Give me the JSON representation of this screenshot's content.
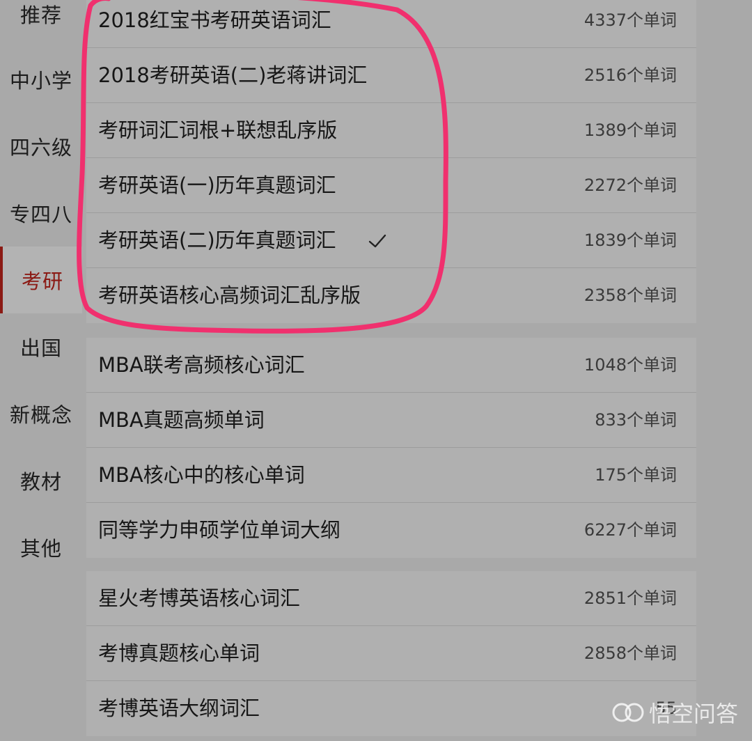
{
  "sidebar": {
    "items": [
      {
        "label": "推荐"
      },
      {
        "label": "中小学"
      },
      {
        "label": "四六级"
      },
      {
        "label": "专四八"
      },
      {
        "label": "考研",
        "active": true
      },
      {
        "label": "出国"
      },
      {
        "label": "新概念"
      },
      {
        "label": "教材"
      },
      {
        "label": "其他"
      }
    ]
  },
  "groups": [
    {
      "rows": [
        {
          "name": "2018红宝书考研英语词汇",
          "count": "4337个单词"
        },
        {
          "name": "2018考研英语(二)老蒋讲词汇",
          "count": "2516个单词"
        },
        {
          "name": "考研词汇词根+联想乱序版",
          "count": "1389个单词"
        },
        {
          "name": "考研英语(一)历年真题词汇",
          "count": "2272个单词"
        },
        {
          "name": "考研英语(二)历年真题词汇",
          "count": "1839个单词",
          "selected": true
        },
        {
          "name": "考研英语核心高频词汇乱序版",
          "count": "2358个单词"
        }
      ]
    },
    {
      "rows": [
        {
          "name": "MBA联考高频核心词汇",
          "count": "1048个单词"
        },
        {
          "name": "MBA真题高频单词",
          "count": "833个单词"
        },
        {
          "name": "MBA核心中的核心单词",
          "count": "175个单词"
        },
        {
          "name": "同等学力申硕学位单词大纲",
          "count": "6227个单词"
        }
      ]
    },
    {
      "rows": [
        {
          "name": "星火考博英语核心词汇",
          "count": "2851个单词"
        },
        {
          "name": "考博真题核心单词",
          "count": "2858个单词"
        },
        {
          "name": "考博英语大纲词汇",
          "count": "55"
        }
      ]
    }
  ],
  "icons": {
    "checkmark": "check-icon",
    "watermark_logo": "wukong-logo-icon"
  },
  "watermark": {
    "text": "悟空问答"
  },
  "colors": {
    "accent": "#8b1a14",
    "annotation": "#f0306e",
    "background": "#a9a9a9",
    "panel": "#b0b0b0"
  }
}
